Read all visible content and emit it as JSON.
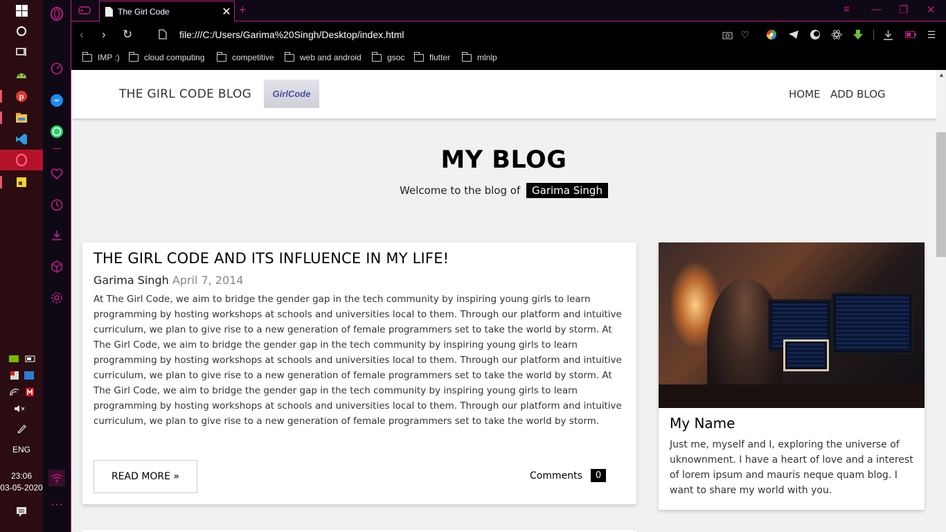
{
  "taskbar": {
    "icons": [
      "windows-start-icon",
      "cortana-icon",
      "task-view-icon",
      "android-studio-icon",
      "pinterest-icon",
      "file-explorer-icon",
      "vscode-icon",
      "opera-icon",
      "sticky-notes-icon"
    ],
    "tray_lang": "ENG",
    "time": "23:06",
    "date": "03-05-2020"
  },
  "browser": {
    "tab_title": "The Girl Code",
    "url": "file:///C:/Users/Garima%20Singh/Desktop/index.html",
    "bookmarks": [
      "IMP :)",
      "cloud computing",
      "competitive",
      "web and android",
      "gsoc",
      "flutter",
      "mlnlp"
    ]
  },
  "site": {
    "brand": "THE GIRL CODE BLOG",
    "logo_text": "GirlCode",
    "nav": {
      "home": "HOME",
      "add_blog": "ADD BLOG"
    },
    "hero": {
      "title": "MY BLOG",
      "subtitle": "Welcome to the blog of",
      "author_tag": "Garima Singh"
    },
    "post": {
      "title": "THE GIRL CODE AND ITS INFLUENCE IN MY LIFE!",
      "author": "Garima Singh",
      "date": "April 7, 2014",
      "body": "At The Girl Code, we aim to bridge the gender gap in the tech community by inspiring young girls to learn programming by hosting workshops at schools and universities local to them. Through our platform and intuitive curriculum, we plan to give rise to a new generation of female programmers set to take the world by storm. At The Girl Code, we aim to bridge the gender gap in the tech community by inspiring young girls to learn programming by hosting workshops at schools and universities local to them. Through our platform and intuitive curriculum, we plan to give rise to a new generation of female programmers set to take the world by storm. At The Girl Code, we aim to bridge the gender gap in the tech community by inspiring young girls to learn programming by hosting workshops at schools and universities local to them. Through our platform and intuitive curriculum, we plan to give rise to a new generation of female programmers set to take the world by storm.",
      "read_more": "READ MORE »",
      "comments_label": "Comments",
      "comments_count": "0"
    },
    "profile": {
      "name": "My Name",
      "bio": "Just me, myself and I, exploring the universe of uknownment. I have a heart of love and a interest of lorem ipsum and mauris neque quam blog. I want to share my world with you."
    }
  }
}
